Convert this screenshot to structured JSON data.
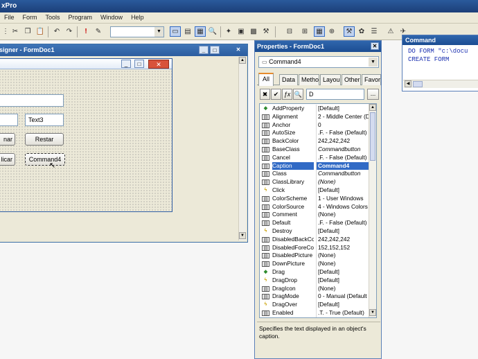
{
  "window": {
    "title": "xPro"
  },
  "menu": [
    "File",
    "Form",
    "Tools",
    "Program",
    "Window",
    "Help"
  ],
  "designer": {
    "title": "signer - FormDoc1",
    "min": "_",
    "max": "□",
    "close": "✕"
  },
  "form": {
    "close": "✕",
    "text3": "Text3",
    "btn_left1": "nar",
    "btn_restar": "Restar",
    "btn_left2": "licar",
    "btn_command4": "Command4"
  },
  "properties": {
    "title": "Properties - FormDoc1",
    "close": "✕",
    "object": "Command4",
    "tabs": [
      "All",
      "Data",
      "Metho",
      "Layou",
      "Other",
      "Favorit"
    ],
    "edit_value": "D",
    "more": "...",
    "rows": [
      {
        "name": "AddProperty",
        "value": "[Default]",
        "kind": "meth"
      },
      {
        "name": "Alignment",
        "value": "2 - Middle Center (D",
        "kind": "prop"
      },
      {
        "name": "Anchor",
        "value": "0",
        "kind": "prop"
      },
      {
        "name": "AutoSize",
        "value": ".F. - False (Default)",
        "kind": "prop"
      },
      {
        "name": "BackColor",
        "value": "242,242,242",
        "kind": "prop"
      },
      {
        "name": "BaseClass",
        "value": "Commandbutton",
        "kind": "prop",
        "italic": true
      },
      {
        "name": "Cancel",
        "value": ".F. - False (Default)",
        "kind": "prop"
      },
      {
        "name": "Caption",
        "value": "Command4",
        "kind": "prop",
        "selected": true
      },
      {
        "name": "Class",
        "value": "Commandbutton",
        "kind": "prop",
        "italic": true
      },
      {
        "name": "ClassLibrary",
        "value": "(None)",
        "kind": "prop",
        "italic": true
      },
      {
        "name": "Click",
        "value": "[Default]",
        "kind": "evt"
      },
      {
        "name": "ColorScheme",
        "value": "1 - User Windows",
        "kind": "prop"
      },
      {
        "name": "ColorSource",
        "value": "4 - Windows Colors",
        "kind": "prop"
      },
      {
        "name": "Comment",
        "value": "(None)",
        "kind": "prop"
      },
      {
        "name": "Default",
        "value": ".F. - False (Default)",
        "kind": "prop"
      },
      {
        "name": "Destroy",
        "value": "[Default]",
        "kind": "evt"
      },
      {
        "name": "DisabledBackCo",
        "value": "242,242,242",
        "kind": "prop"
      },
      {
        "name": "DisabledForeCo",
        "value": "152,152,152",
        "kind": "prop"
      },
      {
        "name": "DisabledPicture",
        "value": "(None)",
        "kind": "prop"
      },
      {
        "name": "DownPicture",
        "value": "(None)",
        "kind": "prop"
      },
      {
        "name": "Drag",
        "value": "[Default]",
        "kind": "meth"
      },
      {
        "name": "DragDrop",
        "value": "[Default]",
        "kind": "evt"
      },
      {
        "name": "DragIcon",
        "value": "(None)",
        "kind": "prop"
      },
      {
        "name": "DragMode",
        "value": "0 - Manual (Default",
        "kind": "prop"
      },
      {
        "name": "DragOver",
        "value": "[Default]",
        "kind": "evt"
      },
      {
        "name": "Enabled",
        "value": ".T. - True (Default)",
        "kind": "prop"
      }
    ],
    "description": "Specifies the text displayed in an object's caption."
  },
  "command": {
    "title": "Command",
    "lines": [
      "DO FORM \"c:\\docu",
      "CREATE FORM"
    ]
  },
  "colors": {
    "accent": "#316ac5",
    "title_blue": "#2a5a9c",
    "face": "#ece9d8"
  }
}
